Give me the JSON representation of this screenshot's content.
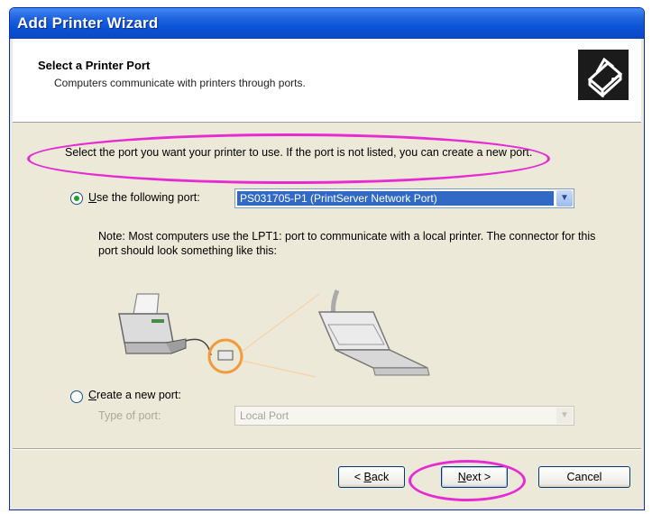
{
  "window": {
    "title": "Add Printer Wizard"
  },
  "header": {
    "title": "Select a Printer Port",
    "subtitle": "Computers communicate with printers through ports.",
    "icon": "printer-port-icon"
  },
  "content": {
    "instruction": "Select the port you want your printer to use.  If the port is not listed, you can create a new port.",
    "use_port": {
      "accel": "U",
      "label_rest": "se the following port:",
      "selected": true,
      "value": "PS031705-P1 (PrintServer Network Port)"
    },
    "note": "Note: Most computers use the LPT1: port to communicate with a local printer. The connector for this port should look something like this:",
    "create_port": {
      "accel": "C",
      "label_rest": "reate a new port:",
      "selected": false,
      "type_label": "Type of port:",
      "type_value": "Local Port"
    }
  },
  "buttons": {
    "back_prefix": "< ",
    "back_accel": "B",
    "back_rest": "ack",
    "next_accel": "N",
    "next_rest": "ext >",
    "cancel": "Cancel"
  },
  "colors": {
    "highlight_ellipse": "#e62bd3",
    "title_bar": "#0a55d8",
    "selection": "#316ac5"
  }
}
